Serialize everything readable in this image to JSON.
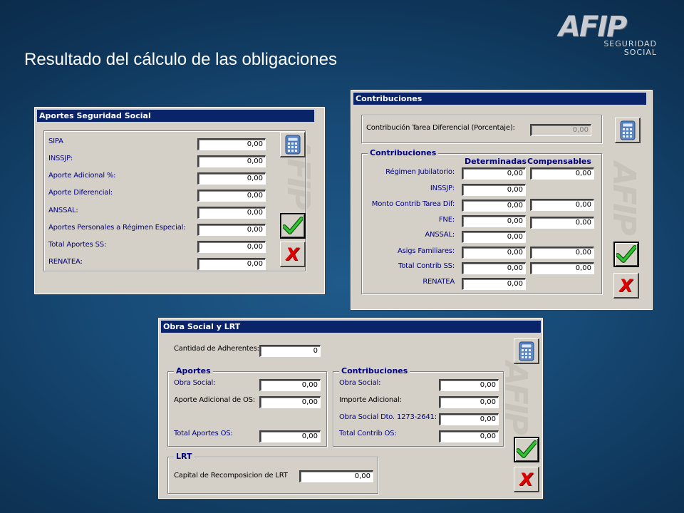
{
  "slide": {
    "title": "Resultado del cálculo de las obligaciones"
  },
  "logo": {
    "mark": "AFIP",
    "line1": "SEGURIDAD",
    "line2": "SOCIAL"
  },
  "aportes_window": {
    "title": "Aportes Seguridad Social",
    "rows": [
      {
        "label": "SIPA",
        "value": "0,00"
      },
      {
        "label": "INSSJP:",
        "value": "0,00"
      },
      {
        "label": "Aporte Adicional %:",
        "value": "0,00"
      },
      {
        "label": "Aporte Diferencial:",
        "value": "0,00"
      },
      {
        "label": "ANSSAL:",
        "value": "0,00"
      },
      {
        "label": "Aportes Personales a Régimen Especial:",
        "value": "0,00"
      },
      {
        "label": "Total Aportes SS:",
        "value": "0,00"
      },
      {
        "label": "RENATEA:",
        "value": "0,00"
      }
    ]
  },
  "contrib_window": {
    "title": "Contribuciones",
    "tarea_label": "Contribución Tarea Diferencial (Porcentaje):",
    "tarea_value": "0,00",
    "group_label": "Contribuciones",
    "col_determinadas": "Determinadas",
    "col_compensables": "Compensables",
    "rows": [
      {
        "label": "Régimen Jubilatorio:",
        "det": "0,00",
        "comp": "0,00"
      },
      {
        "label": "INSSJP:",
        "det": "0,00"
      },
      {
        "label": "Monto Contrib Tarea Dif:",
        "det": "0,00",
        "comp": "0,00"
      },
      {
        "label": "FNE:",
        "det": "0,00",
        "comp": "0,00"
      },
      {
        "label": "ANSSAL:",
        "det": "0,00"
      },
      {
        "label": "Asigs Familiares:",
        "det": "0,00",
        "comp": "0,00"
      },
      {
        "label": "Total Contrib SS:",
        "det": "0,00",
        "comp": "0,00"
      },
      {
        "label": "RENATEA",
        "det": "0,00"
      }
    ]
  },
  "obra_window": {
    "title": "Obra Social y LRT",
    "adherentes_label": "Cantidad de Adherentes:",
    "adherentes_value": "0",
    "aportes": {
      "group_label": "Aportes",
      "rows": [
        {
          "label": "Obra Social:",
          "value": "0,00"
        },
        {
          "label": "Aporte Adicional de OS:",
          "value": "0,00"
        },
        {
          "label": "Total Aportes OS:",
          "value": "0,00"
        }
      ]
    },
    "contribuciones": {
      "group_label": "Contribuciones",
      "rows": [
        {
          "label": "Obra Social:",
          "value": "0,00"
        },
        {
          "label": "Importe Adicional:",
          "value": "0,00"
        },
        {
          "label": "Obra Social Dto. 1273-2641:",
          "value": "0,00"
        },
        {
          "label": "Total Contrib OS:",
          "value": "0,00"
        }
      ]
    },
    "lrt": {
      "group_label": "LRT",
      "label": "Capital de Recomposicion de LRT",
      "value": "0,00"
    }
  },
  "buttons": {
    "cancel_glyph": "X"
  },
  "icons": {
    "calculator": "calculator-icon",
    "accept": "checkmark-icon",
    "cancel": "x-icon"
  },
  "colors": {
    "accent": "#0a246a",
    "label": "#000080",
    "check": "#1aa21a",
    "cancel": "#e00000"
  }
}
